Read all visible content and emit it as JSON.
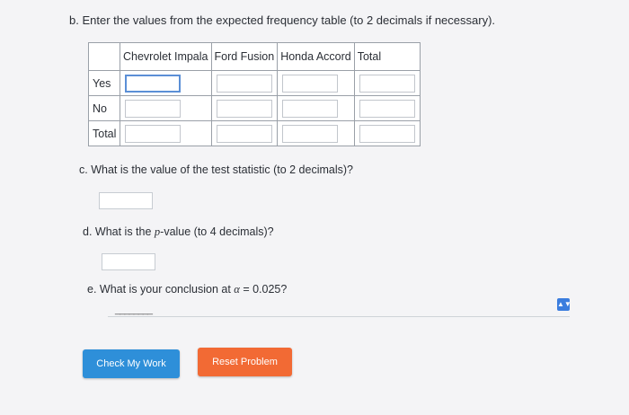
{
  "questions": {
    "b": "b.  Enter the values from the expected frequency table (to 2 decimals if necessary).",
    "c": "c.  What is the value of the test statistic (to 2 decimals)?",
    "d_prefix": "d.  What is the ",
    "d_var": "p",
    "d_suffix": "-value (to 4 decimals)?",
    "e_prefix": "e.  What is your conclusion at ",
    "e_var": "α",
    "e_suffix": " = 0.025?"
  },
  "table": {
    "headers": [
      "",
      "Chevrolet Impala",
      "Ford Fusion",
      "Honda Accord",
      "Total"
    ],
    "rows": [
      "Yes",
      "No",
      "Total"
    ]
  },
  "conclusion_select": {
    "selected": "________"
  },
  "buttons": {
    "check": "Check My Work",
    "reset": "Reset Problem"
  },
  "colors": {
    "check_button": "#2e8fd9",
    "reset_button": "#f26a34",
    "select_arrow": "#3b7dde"
  }
}
